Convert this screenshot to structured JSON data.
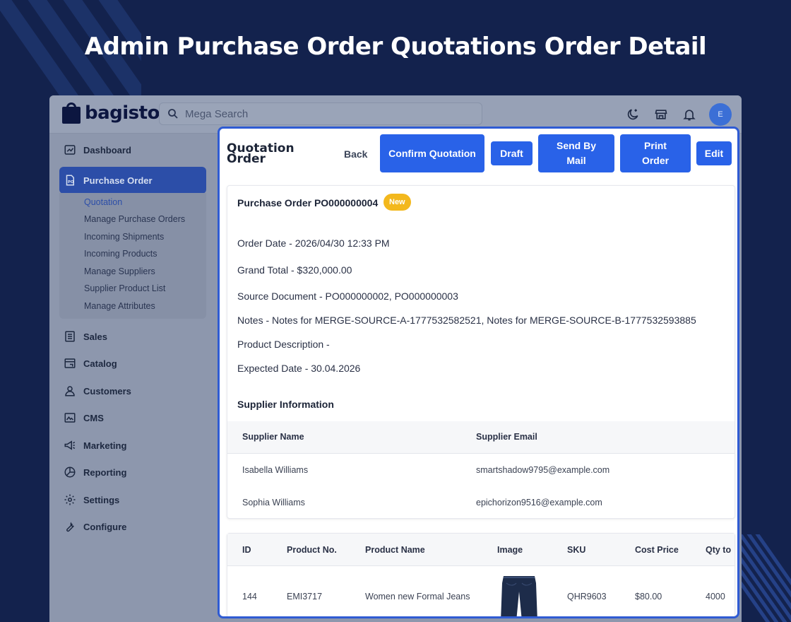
{
  "page_heading": "Admin Purchase Order Quotations Order Detail",
  "app": {
    "logo_text": "bagisto",
    "search_placeholder": "Mega Search",
    "avatar_letter": "E"
  },
  "sidebar": {
    "items": [
      {
        "label": "Dashboard",
        "icon": "dashboard-icon"
      },
      {
        "label": "Purchase Order",
        "icon": "purchase-order-icon"
      },
      {
        "label": "Sales",
        "icon": "sales-icon"
      },
      {
        "label": "Catalog",
        "icon": "catalog-icon"
      },
      {
        "label": "Customers",
        "icon": "customers-icon"
      },
      {
        "label": "CMS",
        "icon": "cms-icon"
      },
      {
        "label": "Marketing",
        "icon": "marketing-icon"
      },
      {
        "label": "Reporting",
        "icon": "reporting-icon"
      },
      {
        "label": "Settings",
        "icon": "settings-icon"
      },
      {
        "label": "Configure",
        "icon": "configure-icon"
      }
    ],
    "submenu": [
      "Quotation",
      "Manage Purchase Orders",
      "Incoming Shipments",
      "Incoming Products",
      "Manage Suppliers",
      "Supplier Product List",
      "Manage Attributes"
    ]
  },
  "modal": {
    "title": "Quotation Order",
    "back_label": "Back",
    "buttons": {
      "confirm": "Confirm Quotation",
      "draft": "Draft",
      "send": "Send By Mail",
      "print": "Print Order",
      "edit": "Edit"
    },
    "po_title": "Purchase Order PO000000004",
    "status_badge": "New",
    "order_date": "Order Date - 2026/04/30 12:33 PM",
    "grand_total": "Grand Total - $320,000.00",
    "source_document": "Source Document - PO000000002, PO000000003",
    "notes": "Notes - Notes for MERGE-SOURCE-A-1777532582521, Notes for MERGE-SOURCE-B-1777532593885",
    "product_description": "Product Description -",
    "expected_date": "Expected Date - 30.04.2026",
    "supplier_section_title": "Supplier Information",
    "supplier_table": {
      "headers": [
        "Supplier Name",
        "Supplier Email"
      ],
      "rows": [
        [
          "Isabella Williams",
          "smartshadow9795@example.com"
        ],
        [
          "Sophia Williams",
          "epichorizon9516@example.com"
        ]
      ]
    },
    "product_table": {
      "headers": [
        "ID",
        "Product No.",
        "Product Name",
        "Image",
        "SKU",
        "Cost Price",
        "Qty to"
      ],
      "rows": [
        [
          "144",
          "EMI3717",
          "Women new Formal Jeans",
          "",
          "QHR9603",
          "$80.00",
          "4000"
        ]
      ]
    }
  },
  "colors": {
    "background": "#13224d",
    "primary": "#2962e8",
    "badge": "#f3b81d"
  }
}
